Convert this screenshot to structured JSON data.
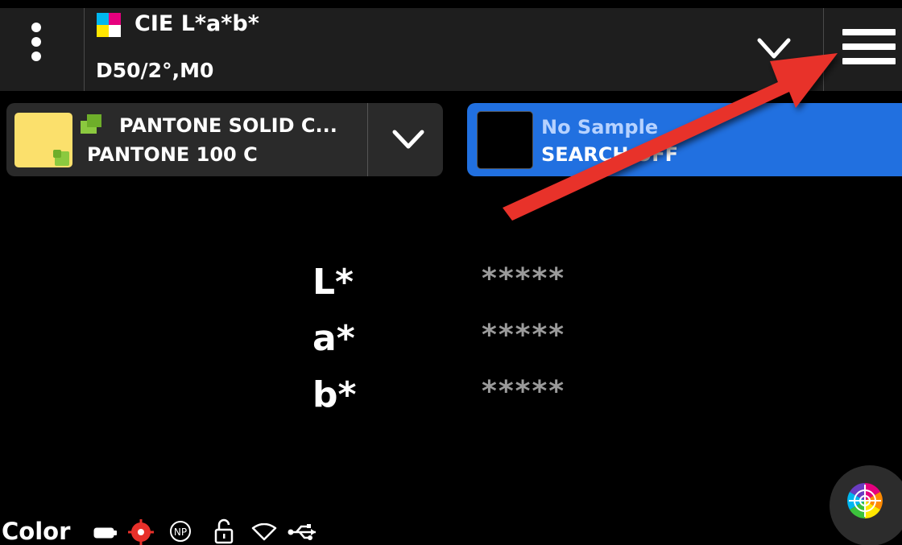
{
  "header": {
    "title": "CIE L*a*b*",
    "subtitle": "D50/2°,M0"
  },
  "library": {
    "name": "PANTONE SOLID C...",
    "color": "PANTONE 100 C",
    "swatch_color": "#fbe06c"
  },
  "sample": {
    "status": "No Sample",
    "search": "SEARCH OFF",
    "accent_color": "#2170e0"
  },
  "readings": [
    {
      "label": "L*",
      "value": "*****"
    },
    {
      "label": "a*",
      "value": "*****"
    },
    {
      "label": "b*",
      "value": "*****"
    }
  ],
  "status_bar": {
    "label": "Color",
    "icons": [
      "battery-icon",
      "target-icon",
      "np-icon",
      "unlock-icon",
      "wifi-icon",
      "usb-icon"
    ]
  },
  "annotation": {
    "arrow_color": "#e8302a"
  }
}
